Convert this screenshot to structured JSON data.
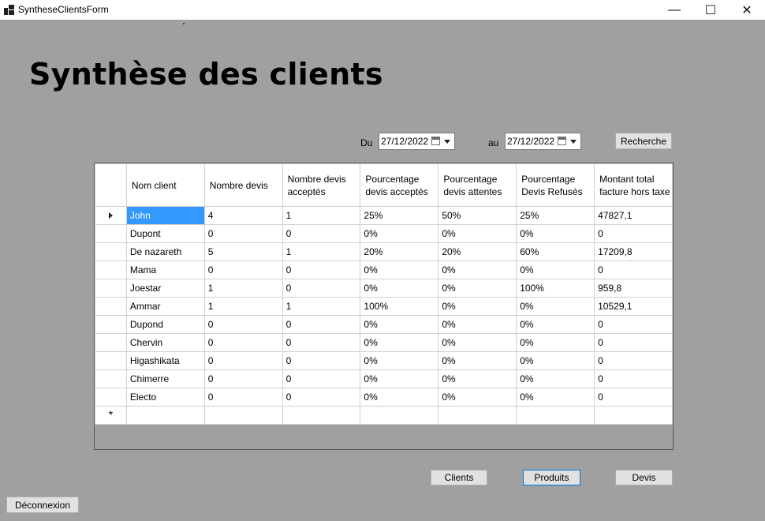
{
  "window": {
    "title": "SyntheseClientsForm",
    "minimize_glyph": "—",
    "maximize_glyph": "☐",
    "close_glyph": "✕"
  },
  "page_title": "Synthèse des clients",
  "filters": {
    "from_label": "Du",
    "from_date": "27/12/2022",
    "to_label": "au",
    "to_date": "27/12/2022",
    "search_button": "Recherche"
  },
  "grid": {
    "columns": [
      "Nom client",
      "Nombre devis",
      "Nombre devis acceptés",
      "Pourcentage devis acceptés",
      "Pourcentage devis attentes",
      "Pourcentage Devis Refusés",
      "Montant total facture hors taxe"
    ],
    "rows": [
      [
        "John",
        "4",
        "1",
        "25%",
        "50%",
        "25%",
        "47827,1"
      ],
      [
        "Dupont",
        "0",
        "0",
        "0%",
        "0%",
        "0%",
        "0"
      ],
      [
        "De nazareth",
        "5",
        "1",
        "20%",
        "20%",
        "60%",
        "17209,8"
      ],
      [
        "Mama",
        "0",
        "0",
        "0%",
        "0%",
        "0%",
        "0"
      ],
      [
        "Joestar",
        "1",
        "0",
        "0%",
        "0%",
        "100%",
        "959,8"
      ],
      [
        "Ammar",
        "1",
        "1",
        "100%",
        "0%",
        "0%",
        "10529,1"
      ],
      [
        "Dupond",
        "0",
        "0",
        "0%",
        "0%",
        "0%",
        "0"
      ],
      [
        "Chervin",
        "0",
        "0",
        "0%",
        "0%",
        "0%",
        "0"
      ],
      [
        "Higashikata",
        "0",
        "0",
        "0%",
        "0%",
        "0%",
        "0"
      ],
      [
        "Chimerre",
        "0",
        "0",
        "0%",
        "0%",
        "0%",
        "0"
      ],
      [
        "Electo",
        "0",
        "0",
        "0%",
        "0%",
        "0%",
        "0"
      ]
    ],
    "selected_row": 0,
    "new_row_marker": "*"
  },
  "nav_buttons": {
    "clients": "Clients",
    "produits": "Produits",
    "devis": "Devis"
  },
  "logout_button": "Déconnexion",
  "colors": {
    "form_background": "#a0a0a0",
    "selection": "#3399ff",
    "focus_border": "#0078d7"
  }
}
